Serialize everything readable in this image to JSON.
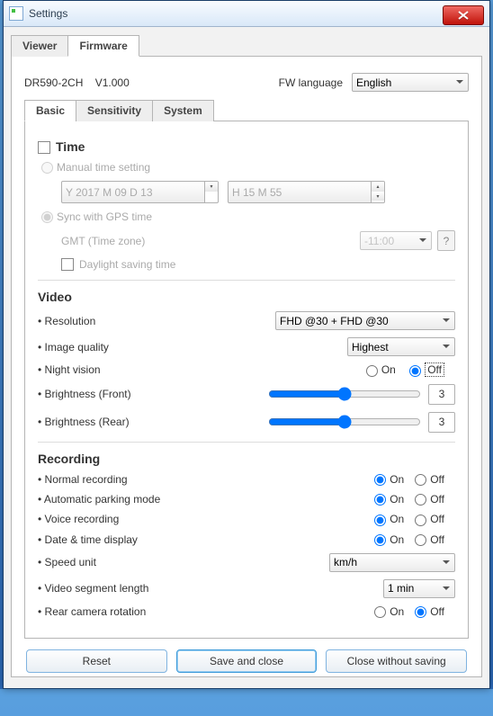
{
  "window": {
    "title": "Settings"
  },
  "top_tabs": [
    "Viewer",
    "Firmware"
  ],
  "top_tab_active": 1,
  "device": {
    "model": "DR590-2CH",
    "version": "V1.000",
    "fw_language_label": "FW language",
    "fw_language_value": "English"
  },
  "sub_tabs": [
    "Basic",
    "Sensitivity",
    "System"
  ],
  "sub_tab_active": 0,
  "time": {
    "heading": "Time",
    "manual_label": "Manual time setting",
    "date_value": "Y 2017 M 09 D 13",
    "time_value": "H 15 M 55",
    "sync_label": "Sync with GPS time",
    "gmt_label": "GMT (Time zone)",
    "gmt_value": "-11:00",
    "dst_label": "Daylight saving time"
  },
  "video": {
    "heading": "Video",
    "resolution_label": "Resolution",
    "resolution_value": "FHD @30 + FHD @30",
    "image_quality_label": "Image quality",
    "image_quality_value": "Highest",
    "night_vision_label": "Night vision",
    "on": "On",
    "off": "Off",
    "night_vision_value": "Off",
    "brightness_front_label": "Brightness (Front)",
    "brightness_front_value": "3",
    "brightness_rear_label": "Brightness (Rear)",
    "brightness_rear_value": "3"
  },
  "recording": {
    "heading": "Recording",
    "normal_label": "Normal recording",
    "normal_value": "On",
    "parking_label": "Automatic parking mode",
    "parking_value": "On",
    "voice_label": "Voice recording",
    "voice_value": "On",
    "datetime_label": "Date & time display",
    "datetime_value": "On",
    "speed_unit_label": "Speed unit",
    "speed_unit_value": "km/h",
    "segment_label": "Video segment length",
    "segment_value": "1 min",
    "rear_rot_label": "Rear camera rotation",
    "rear_rot_value": "Off"
  },
  "footer": {
    "reset": "Reset",
    "save": "Save and close",
    "close": "Close without saving"
  }
}
